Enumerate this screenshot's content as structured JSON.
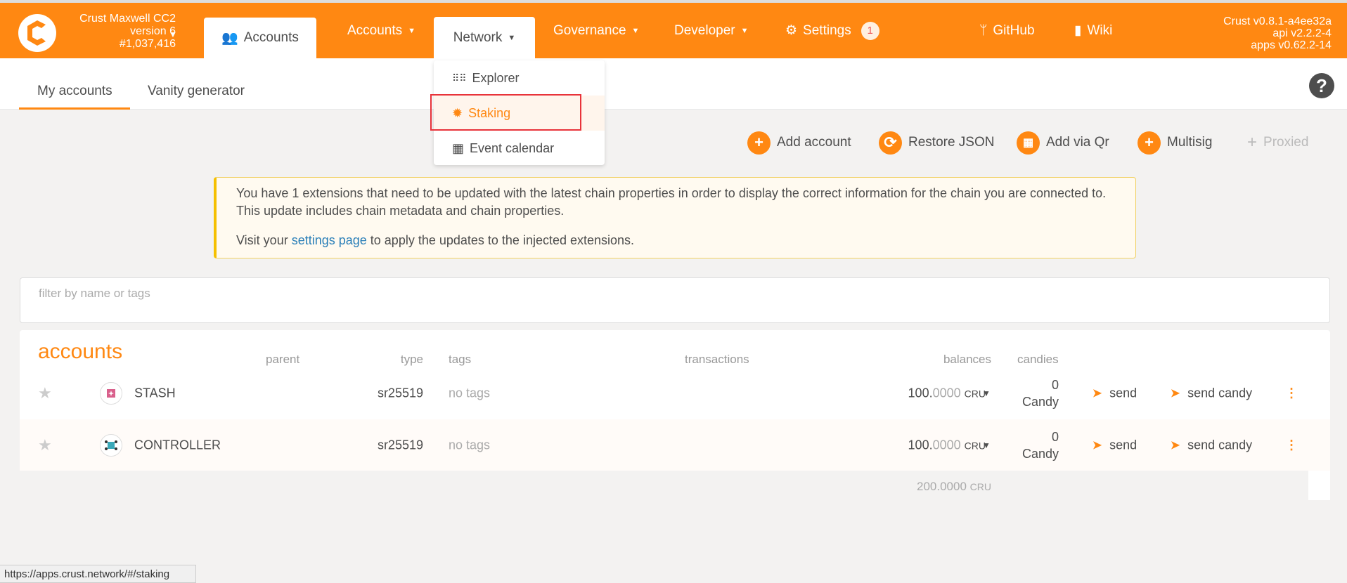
{
  "header": {
    "chain_name": "Crust Maxwell CC2",
    "chain_version": "version 6",
    "block": "#1,037,416",
    "tabs": [
      {
        "label": "Accounts"
      },
      {
        "label": "Accounts"
      },
      {
        "label": "Network"
      },
      {
        "label": "Governance"
      },
      {
        "label": "Developer"
      },
      {
        "label": "Settings",
        "badge": "1"
      },
      {
        "label": "GitHub"
      },
      {
        "label": "Wiki"
      }
    ],
    "versions": [
      "Crust v0.8.1-a4ee32a",
      "api v2.2.2-4",
      "apps v0.62.2-14"
    ]
  },
  "subnav": {
    "tabs": [
      "My accounts",
      "Vanity generator"
    ],
    "help": "?"
  },
  "network_menu": {
    "items": [
      "Explorer",
      "Staking",
      "Event calendar"
    ]
  },
  "actions": [
    "Add account",
    "Restore JSON",
    "Add via Qr",
    "Multisig",
    "Proxied"
  ],
  "warning": {
    "line1": "You have 1 extensions that need to be updated with the latest chain properties in order to display the correct information for the chain you are connected to. This update includes chain metadata and chain properties.",
    "pre": "Visit your ",
    "link": "settings page",
    "post": " to apply the updates to the injected extensions."
  },
  "filter": {
    "placeholder": "filter by name or tags"
  },
  "table": {
    "title": "accounts",
    "headers": [
      "parent",
      "type",
      "tags",
      "transactions",
      "balances",
      "candies"
    ],
    "rows": [
      {
        "name": "STASH",
        "type": "sr25519",
        "tags": "no tags",
        "balance_int": "100.",
        "balance_dec": "0000",
        "unit": "CRU",
        "candies": "0",
        "candy_unit": "Candy",
        "send": "send",
        "send_candy": "send candy"
      },
      {
        "name": "CONTROLLER",
        "type": "sr25519",
        "tags": "no tags",
        "balance_int": "100.",
        "balance_dec": "0000",
        "unit": "CRU",
        "candies": "0",
        "candy_unit": "Candy",
        "send": "send",
        "send_candy": "send candy"
      }
    ],
    "total": "200.0000",
    "total_unit": "CRU"
  },
  "status_url": "https://apps.crust.network/#/staking",
  "colors": {
    "accent": "#ff8812",
    "highlight": "#e8333a"
  }
}
